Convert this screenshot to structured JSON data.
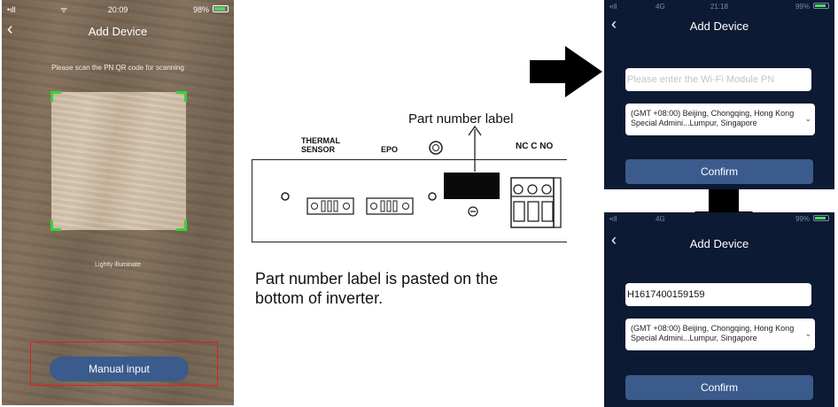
{
  "left_phone": {
    "status": {
      "signal": "•ıll",
      "wifi": "ᯤ",
      "time": "20:09",
      "battery": "98%"
    },
    "title": "Add Device",
    "scan_hint": "Please scan the PN QR code for scanning",
    "illuminate": "Lightly illuminate",
    "manual_button": "Manual input"
  },
  "diagram": {
    "part_label": "Part number label",
    "thermal_sensor": [
      "THERMAL",
      "SENSOR"
    ],
    "epo": "EPO",
    "terminal": "NC C NO",
    "caption": "Part number label is pasted on the bottom of inverter."
  },
  "phone_top": {
    "status": {
      "signal": "•ıll",
      "network": "4G",
      "time": "21:18",
      "battery": "99%"
    },
    "title": "Add Device",
    "pn_placeholder": "Please enter the Wi-Fi Module PN",
    "timezone": "(GMT +08:00) Beijing, Chongqing, Hong Kong Special Admini...Lumpur, Singapore",
    "confirm": "Confirm"
  },
  "phone_bottom": {
    "status": {
      "signal": "•ıll",
      "network": "4G",
      "time": "",
      "battery": "99%"
    },
    "title": "Add Device",
    "pn_value": "H1617400159159",
    "timezone": "(GMT +08:00) Beijing, Chongqing, Hong Kong Special Admini...Lumpur, Singapore",
    "confirm": "Confirm"
  },
  "colors": {
    "button_blue": "#3b5b8c",
    "phone_bg": "#0c1a33",
    "scan_corner": "#3ad13a",
    "highlight_red": "#e02020"
  }
}
